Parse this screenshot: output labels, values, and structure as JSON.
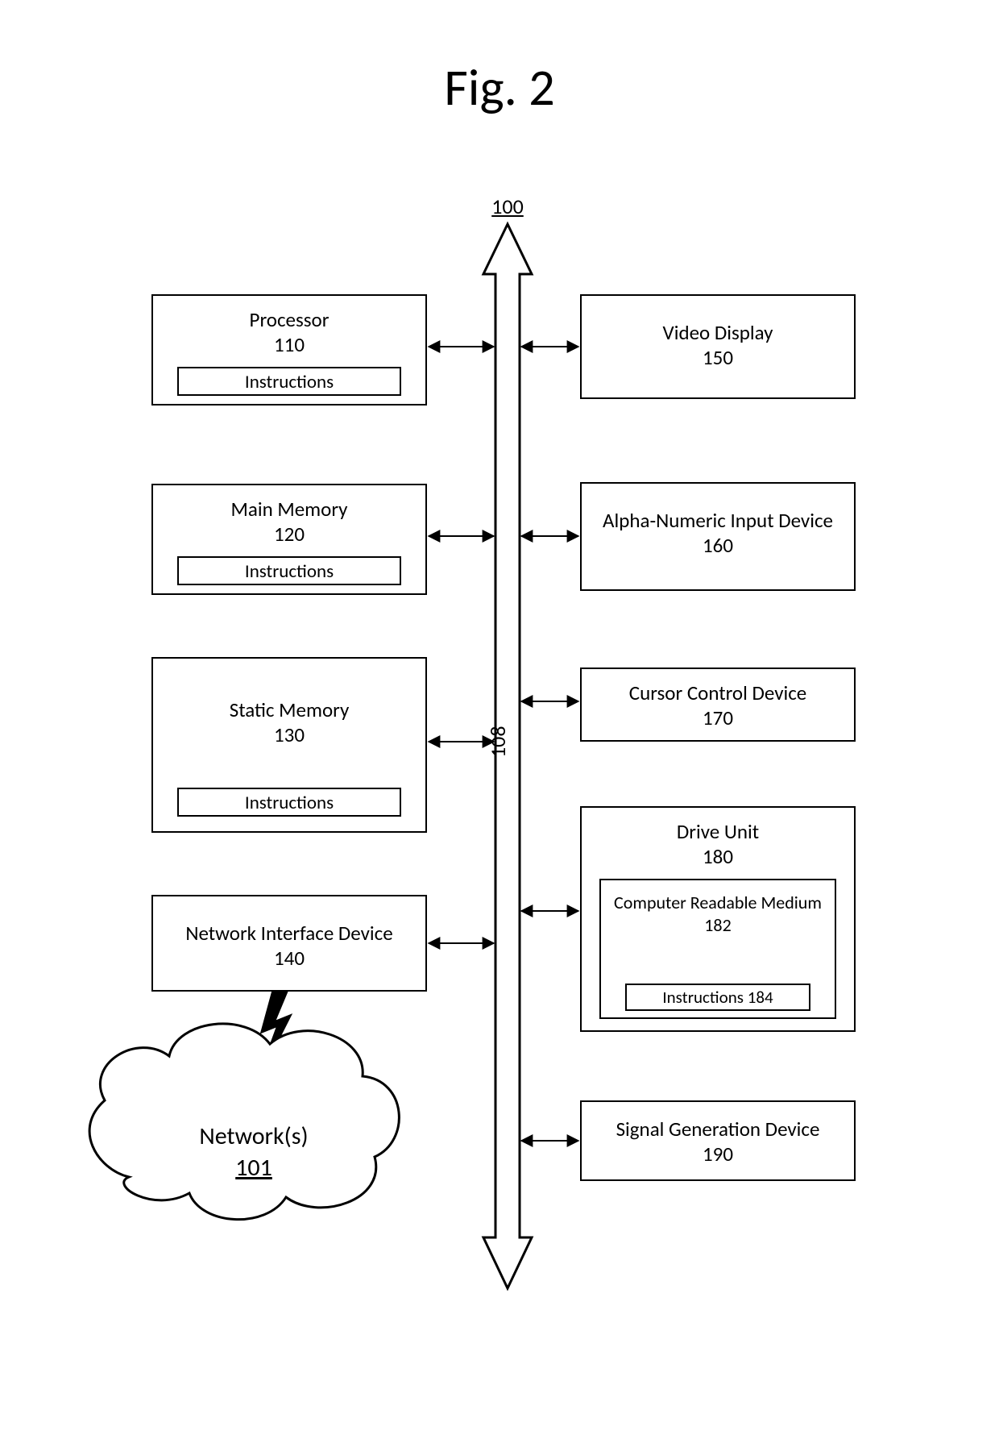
{
  "figure_title": "Fig. 2",
  "system_ref": "100",
  "bus_ref": "108",
  "instructions_label": "Instructions",
  "boxes": {
    "processor": {
      "label": "Processor",
      "ref": "110"
    },
    "main_memory": {
      "label": "Main Memory",
      "ref": "120"
    },
    "static_mem": {
      "label": "Static Memory",
      "ref": "130"
    },
    "net_if": {
      "label": "Network Interface Device",
      "ref": "140"
    },
    "video": {
      "label": "Video Display",
      "ref": "150"
    },
    "alnum": {
      "label": "Alpha-Numeric Input Device",
      "ref": "160"
    },
    "cursor": {
      "label": "Cursor Control Device",
      "ref": "170"
    },
    "drive_unit": {
      "label": "Drive Unit",
      "ref": "180"
    },
    "crm": {
      "label": "Computer Readable Medium",
      "ref": "182"
    },
    "crm_instr": {
      "label": "Instructions 184"
    },
    "siggen": {
      "label": "Signal Generation Device",
      "ref": "190"
    }
  },
  "network": {
    "label": "Network(s)",
    "ref": "101"
  }
}
